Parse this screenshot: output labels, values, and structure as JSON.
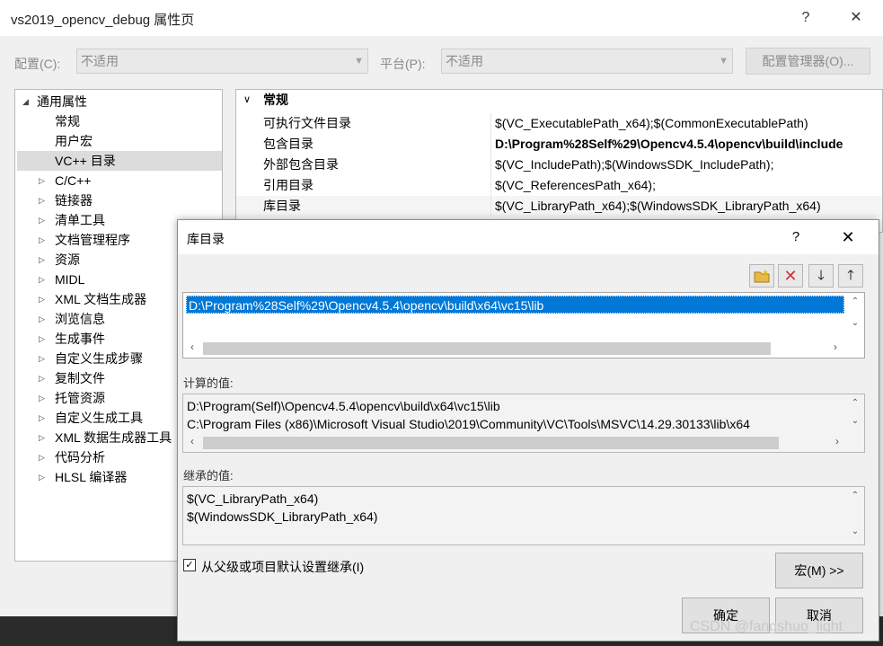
{
  "window": {
    "title": "vs2019_opencv_debug 属性页",
    "help": "?",
    "close": "✕"
  },
  "config": {
    "config_label": "配置(C):",
    "config_value": "不适用",
    "platform_label": "平台(P):",
    "platform_value": "不适用",
    "manager_button": "配置管理器(O)..."
  },
  "tree": {
    "root": "通用属性",
    "items": [
      {
        "label": "常规"
      },
      {
        "label": "用户宏"
      },
      {
        "label": "VC++ 目录"
      },
      {
        "label": "C/C++"
      },
      {
        "label": "链接器"
      },
      {
        "label": "清单工具"
      },
      {
        "label": "文档管理程序"
      },
      {
        "label": "资源"
      },
      {
        "label": "MIDL"
      },
      {
        "label": "XML 文档生成器"
      },
      {
        "label": "浏览信息"
      },
      {
        "label": "生成事件"
      },
      {
        "label": "自定义生成步骤"
      },
      {
        "label": "复制文件"
      },
      {
        "label": "托管资源"
      },
      {
        "label": "自定义生成工具"
      },
      {
        "label": "XML 数据生成器工具"
      },
      {
        "label": "代码分析"
      },
      {
        "label": "HLSL 编译器"
      }
    ]
  },
  "grid": {
    "section": "常规",
    "rows": [
      {
        "name": "可执行文件目录",
        "value": "$(VC_ExecutablePath_x64);$(CommonExecutablePath)"
      },
      {
        "name": "包含目录",
        "value": "D:\\Program%28Self%29\\Opencv4.5.4\\opencv\\build\\include"
      },
      {
        "name": "外部包含目录",
        "value": "$(VC_IncludePath);$(WindowsSDK_IncludePath);"
      },
      {
        "name": "引用目录",
        "value": "$(VC_ReferencesPath_x64);"
      },
      {
        "name": "库目录",
        "value": "$(VC_LibraryPath_x64);$(WindowsSDK_LibraryPath_x64)"
      }
    ]
  },
  "dialog": {
    "title": "库目录",
    "help": "?",
    "close": "✕",
    "list_items": [
      "D:\\Program%28Self%29\\Opencv4.5.4\\opencv\\build\\x64\\vc15\\lib"
    ],
    "evaluated_label": "计算的值:",
    "evaluated_values": [
      "D:\\Program(Self)\\Opencv4.5.4\\opencv\\build\\x64\\vc15\\lib",
      "C:\\Program Files (x86)\\Microsoft Visual Studio\\2019\\Community\\VC\\Tools\\MSVC\\14.29.30133\\lib\\x64"
    ],
    "inherited_label": "继承的值:",
    "inherited_values": [
      "$(VC_LibraryPath_x64)",
      "$(WindowsSDK_LibraryPath_x64)"
    ],
    "inherit_checkbox": "从父级或项目默认设置继承(I)",
    "inherit_checked": true,
    "macros_button": "宏(M) >>",
    "ok_button": "确定",
    "cancel_button": "取消"
  },
  "watermark": "CSDN @fangshuo_light",
  "colors": {
    "selection": "#0078d7",
    "delete_icon": "#d13438",
    "folder_icon": "#e8b84a"
  }
}
